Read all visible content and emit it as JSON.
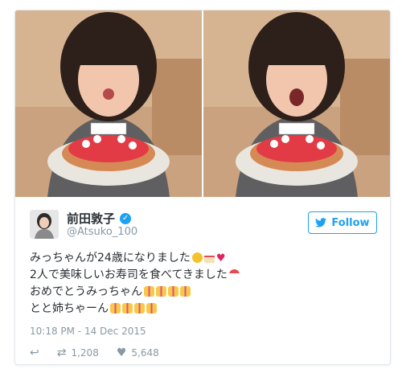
{
  "user": {
    "name": "前田敦子",
    "handle": "@Atsuko_100",
    "verified": true
  },
  "follow_button": {
    "label": "Follow",
    "color": "#1da1f2"
  },
  "tweet": {
    "lines": [
      "みっちゃんが24歳になりました",
      "2人で美味しいお寿司を食べてきました",
      "おめでとうみっちゃん",
      "とと姉ちゃーん"
    ],
    "timestamp": "10:18 PM - 14 Dec 2015"
  },
  "stats": {
    "retweets": "1,208",
    "likes": "5,648"
  },
  "icons": {
    "reply": "reply-icon",
    "retweet": "retweet-icon",
    "like": "heart-icon",
    "bird": "twitter-bird-icon",
    "verified": "verified-check-icon"
  }
}
